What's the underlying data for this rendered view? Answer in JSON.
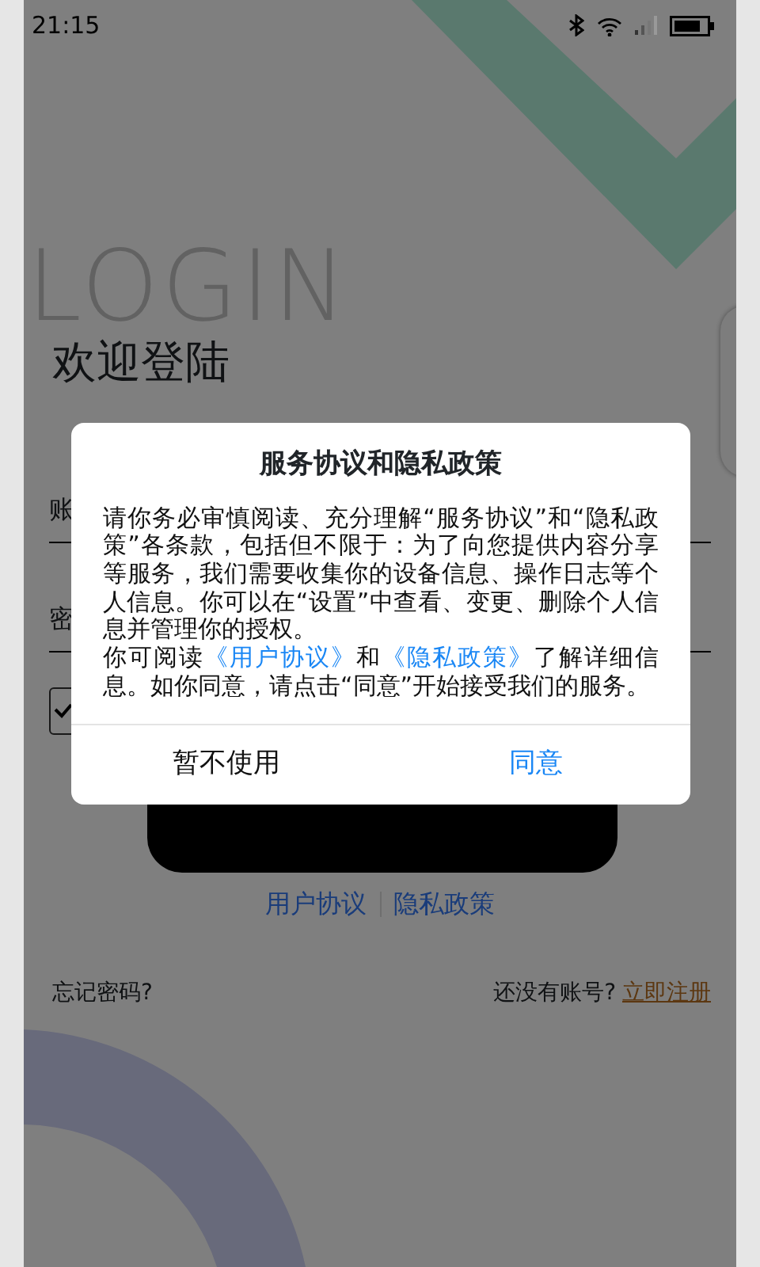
{
  "status_bar": {
    "time": "21:15"
  },
  "background": {
    "watermark": "LOGIN",
    "title": "欢迎登陆",
    "account_label": "账",
    "password_label": "密",
    "agree_checkbox": {
      "checked": true
    },
    "links": [
      "用户协议",
      "隐私政策"
    ],
    "forgot_password": "忘记密码?",
    "no_account": "还没有账号?",
    "register": "立即注册"
  },
  "dialog": {
    "title": "服务协议和隐私政策",
    "body": "请你务必审慎阅读、充分理解“服务协议”和“隐私政策”各条款，包括但不限于：为了向您提供内容分享等服务，我们需要收集你的设备信息、操作日志等个人信息。你可以在“设置”中查看、变更、删除个人信息并管理你的授权。",
    "body2_parts": [
      {
        "kind": "text",
        "text": "你可阅读"
      },
      {
        "kind": "link",
        "text": "《用户协议》"
      },
      {
        "kind": "text",
        "text": "和"
      },
      {
        "kind": "link",
        "text": "《隐私政策》"
      },
      {
        "kind": "text",
        "text": "了解详细信息。如你同意，请点击“同意”开始接受我们的服务。"
      }
    ],
    "buttons": [
      {
        "label": "暂不使用",
        "kind": "cancel"
      },
      {
        "label": "同意",
        "kind": "confirm"
      }
    ]
  }
}
